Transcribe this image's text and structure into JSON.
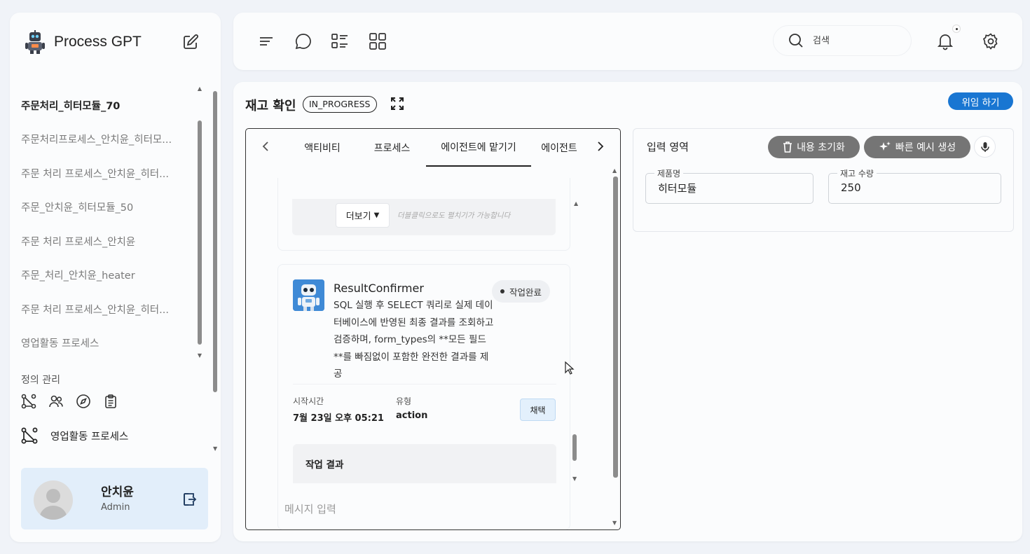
{
  "app": {
    "title": "Process GPT"
  },
  "sidebar": {
    "processes": [
      {
        "label": "주문처리_히터모듈_70",
        "active": true
      },
      {
        "label": "주문처리프로세스_안치윤_히터모..."
      },
      {
        "label": "주문 처리 프로세스_안치윤_히터..."
      },
      {
        "label": "주문_안치윤_히터모듈_50"
      },
      {
        "label": "주문 처리 프로세스_안치윤"
      },
      {
        "label": "주문_처리_안치윤_heater"
      },
      {
        "label": "주문 처리 프로세스_안치윤_히터..."
      },
      {
        "label": "영업활동 프로세스"
      }
    ],
    "definition_title": "정의 관리",
    "definition_icons": [
      "process-graph-icon",
      "users-icon",
      "compass-icon",
      "clipboard-icon"
    ],
    "definition_process": "영업활동 프로세스",
    "user": {
      "name": "안치윤",
      "role": "Admin"
    }
  },
  "topbar": {
    "icons": [
      "menu-lines-icon",
      "chat-bubble-icon",
      "list-icon",
      "grid-icon"
    ],
    "search_placeholder": "검색"
  },
  "main": {
    "title": "재고 확인",
    "status": "IN_PROGRESS",
    "delegate_label": "위임 하기",
    "tabs": [
      {
        "label": "액티비티",
        "width": 122
      },
      {
        "label": "프로세스",
        "width": 97
      },
      {
        "label": "에이전트에 맡기기",
        "width": 150
      },
      {
        "label": "에이전트",
        "width": 80
      }
    ],
    "active_tab": 2,
    "card1": {
      "more_label": "더보기",
      "more_hint": "더블클릭으로도 펼치기가 가능합니다"
    },
    "agent": {
      "name": "ResultConfirmer",
      "description": "SQL 실행 후 SELECT 쿼리로 실제 데이터베이스에 반영된 최종 결과를 조회하고 검증하며, form_types의 **모든 필드**를 빠짐없이 포함한 완전한 결과를 제공",
      "status": "작업완료",
      "start_label": "시작시간",
      "start_value": "7월 23일 오후 05:21",
      "type_label": "유형",
      "type_value": "action",
      "adopt_label": "채택",
      "result_title": "작업 결과"
    },
    "message_placeholder": "메시지 입력",
    "input_area": {
      "title": "입력 영역",
      "reset_label": "내용 초기화",
      "generate_label": "빠른 예시 생성",
      "fields": [
        {
          "label": "제품명",
          "value": "히터모듈"
        },
        {
          "label": "재고 수량",
          "value": "250"
        }
      ]
    }
  },
  "colors": {
    "primary": "#1976d2",
    "grey_button": "#757575",
    "user_card": "#e2eefa"
  }
}
